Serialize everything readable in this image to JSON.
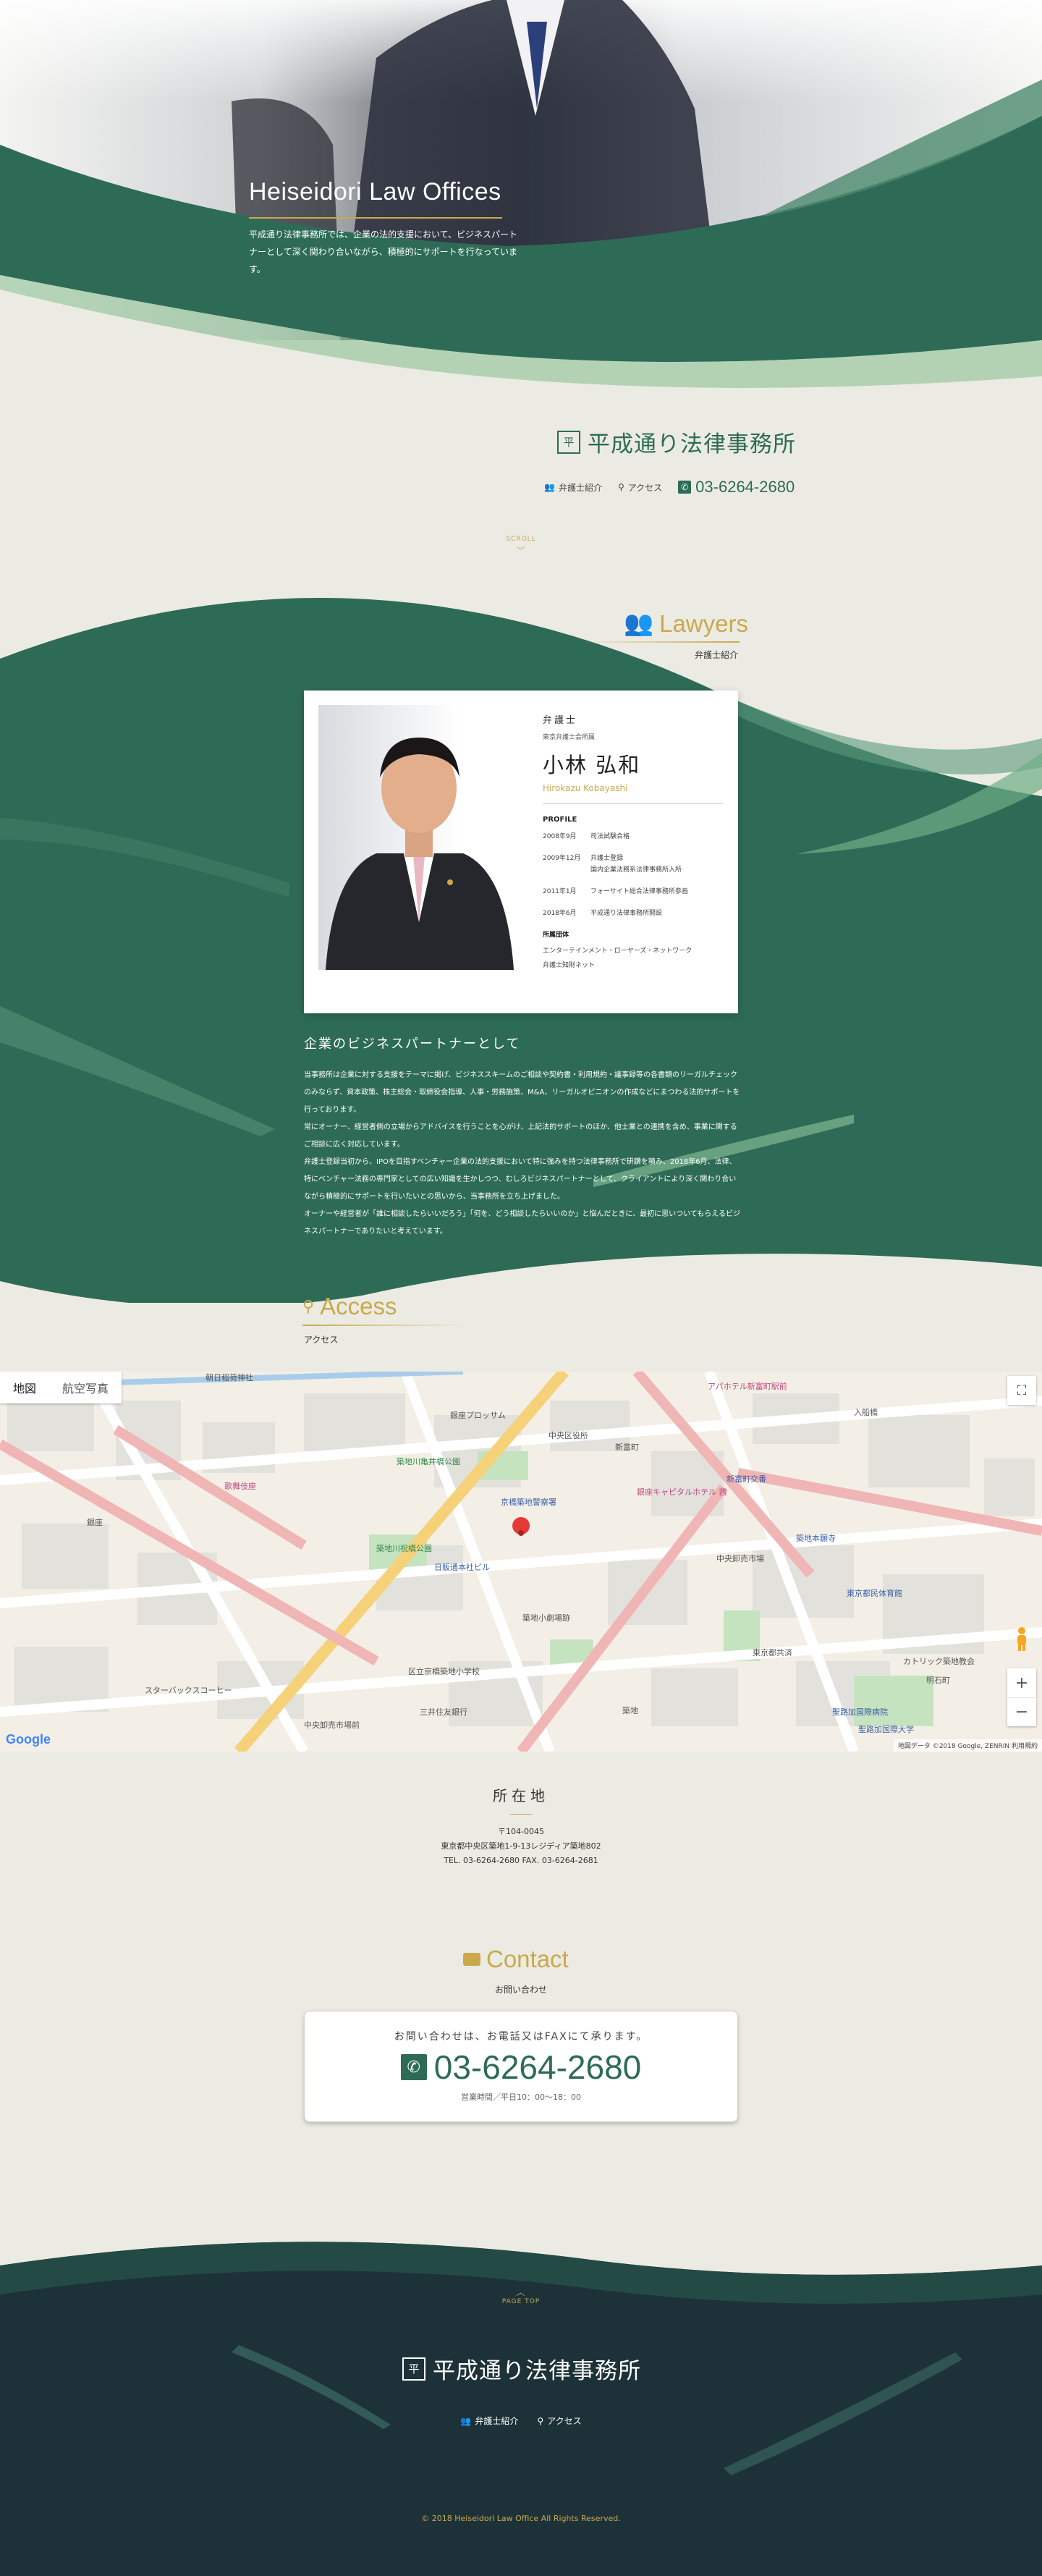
{
  "hero": {
    "title": "Heiseidori Law Offices",
    "text": "平成通り法律事務所では、企業の法的支援において、ビジネスパートナーとして深く関わり合いながら、積極的にサポートを行なっています。"
  },
  "brand": {
    "mark": "平",
    "name": "平成通り法律事務所"
  },
  "topnav": {
    "lawyers": "弁護士紹介",
    "access": "アクセス",
    "tel": "03-6264-2680"
  },
  "scroll": "SCROLL",
  "lawyers": {
    "heading": "Lawyers",
    "sub": "弁護士紹介",
    "role": "弁護士",
    "association": "東京弁護士会所属",
    "name_ja": "小林 弘和",
    "name_en": "Hirokazu Kobayashi",
    "profile_title": "PROFILE",
    "profile": [
      {
        "date": "2008年9月",
        "text": "司法試験合格"
      },
      {
        "date": "2009年12月",
        "text": "弁護士登録\n国内企業法務系法律事務所入所"
      },
      {
        "date": "2011年1月",
        "text": "フォーサイト総合法律事務所参画"
      },
      {
        "date": "2018年6月",
        "text": "平成通り法律事務所開設"
      }
    ],
    "affil_title": "所属団体",
    "affil": [
      "エンターテインメント・ローヤーズ・ネットワーク",
      "弁護士知財ネット"
    ]
  },
  "about": {
    "heading": "企業のビジネスパートナーとして",
    "paragraphs": [
      "当事務所は企業に対する支援をテーマに掲げ、ビジネススキームのご相談や契約書・利用規約・議事録等の各書類のリーガルチェックのみならず、資本政策、株主総会・取締役会指導、人事・労務施策、M&A、リーガルオピニオンの作成などにまつわる法的サポートを行っております。",
      "常にオーナー、経営者側の立場からアドバイスを行うことを心がけ、上記法的サポートのほか、他士業との連携を含め、事業に関するご相談に広く対応しています。",
      "弁護士登録当初から、IPOを目指すベンチャー企業の法的支援において特に強みを持つ法律事務所で研鑽を積み、2018年6月、法律、特にベンチャー法務の専門家としての広い知識を生かしつつ、むしろビジネスパートナーとして、クライアントにより深く関わり合いながら積極的にサポートを行いたいとの思いから、当事務所を立ち上げました。",
      "オーナーや経営者が「誰に相談したらいいだろう」「何を、どう相談したらいいのか」と悩んだときに、最初に思いついてもらえるビジネスパートナーでありたいと考えています。"
    ]
  },
  "access": {
    "heading": "Access",
    "sub": "アクセス",
    "map_tab_map": "地図",
    "map_tab_sat": "航空写真",
    "map_google": "Google",
    "map_credit": "地図データ ©2018 Google, ZENRIN  利用規約",
    "map_labels": {
      "l1": "朝日稲荷神社",
      "l2": "アパホテル新富町駅前",
      "l3": "築地川亀井橋公園",
      "l4": "中央区役所",
      "l5": "銀座プロッサム",
      "l6": "京橋築地警察署",
      "l7": "築地川祝橋公園",
      "l8": "日販通本社ビル",
      "l9": "築地小劇場跡",
      "l10": "区立京橋築地小学校",
      "l11": "銀座キャピタルホテル 茜",
      "l12": "東京都民体育館",
      "l13": "聖路加国際病院",
      "l14": "スターバックスコーヒー",
      "l15": "中央卸売市場",
      "l16": "東京都共済",
      "l17": "築地本願寺",
      "l18": "三井住友銀行",
      "l19": "新富町",
      "l20": "入船橋",
      "l21": "聖路加国際大学",
      "l22": "明石町",
      "l23": "新富町交番",
      "l24": "カトリック築地教会",
      "l25": "築地",
      "l26": "中央卸売市場前",
      "l27": "銀座",
      "l28": "歌舞伎座"
    }
  },
  "address": {
    "heading": "所在地",
    "zip": "〒104-0045",
    "line": "東京都中央区築地1-9-13レジディア築地802",
    "tel": "TEL. 03-6264-2680  FAX. 03-6264-2681"
  },
  "contact": {
    "heading": "Contact",
    "sub": "お問い合わせ",
    "lead": "お問い合わせは、お電話又はFAXにて承ります。",
    "tel": "03-6264-2680",
    "hours": "営業時間／平日10：00〜18：00"
  },
  "footer": {
    "pagetop": "PAGE TOP",
    "lawyers": "弁護士紹介",
    "access": "アクセス",
    "copyright": "© 2018 Heiseidori Law Office All Rights Reserved."
  },
  "colors": {
    "green": "#2e6b57",
    "dark": "#1d3238",
    "gold": "#c9a94b",
    "bg": "#ecebe3"
  }
}
